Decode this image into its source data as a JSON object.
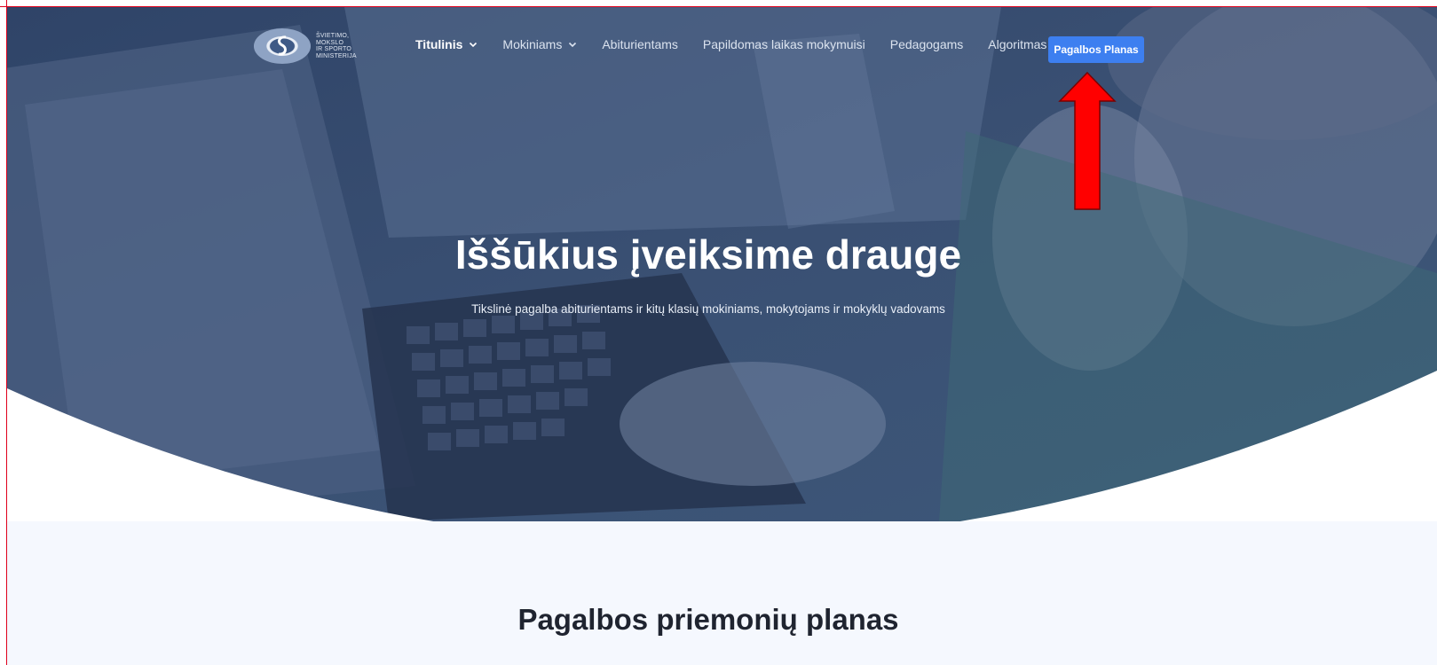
{
  "logo": {
    "lines": [
      "ŠVIETIMO,",
      "MOKSLO",
      "IR SPORTO",
      "MINISTERIJA"
    ]
  },
  "nav": {
    "items": [
      {
        "label": "Titulinis",
        "active": true,
        "dropdown": true
      },
      {
        "label": "Mokiniams",
        "active": false,
        "dropdown": true
      },
      {
        "label": "Abiturientams",
        "active": false,
        "dropdown": false
      },
      {
        "label": "Papildomas laikas mokymuisi",
        "active": false,
        "dropdown": false
      },
      {
        "label": "Pedagogams",
        "active": false,
        "dropdown": false
      },
      {
        "label": "Algoritmas",
        "active": false,
        "dropdown": false
      }
    ],
    "cta_label": "Pagalbos Planas"
  },
  "hero": {
    "title": "Iššūkius įveiksime drauge",
    "subtitle": "Tikslinė pagalba abiturientams ir kitų klasių mokiniams, mokytojams ir mokyklų vadovams"
  },
  "section": {
    "title": "Pagalbos priemonių planas"
  },
  "colors": {
    "hero_overlay": "#2a3f63",
    "cta_bg": "#3d7ff0",
    "annotation_arrow": "#ff0000",
    "section_bg": "#f5f8fe"
  },
  "icons": {
    "dropdown": "chevron-down-icon",
    "annotation": "red-arrow-up-icon"
  }
}
